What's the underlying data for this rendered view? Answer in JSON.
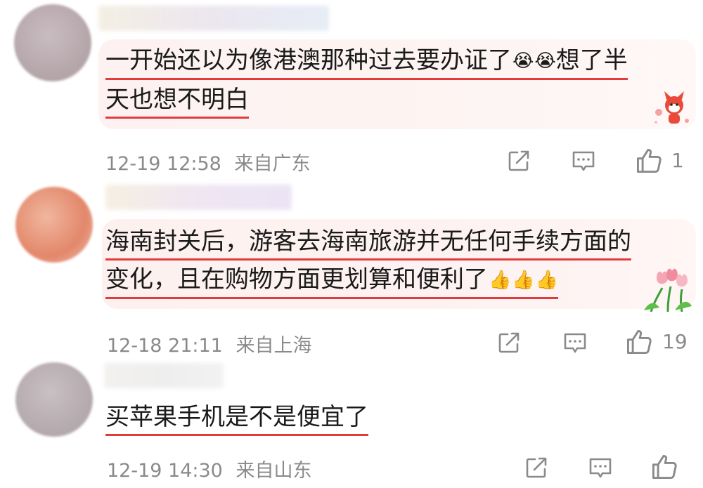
{
  "comments": [
    {
      "lines": [
        "一开始还以为像港澳那种过去要办证了",
        "天也想不明白"
      ],
      "line1_tail": "想了半",
      "emojis": [
        "😭",
        "😭"
      ],
      "time": "12-19 12:58",
      "location": "来自广东",
      "likes": "1",
      "avatar_color": "#b8a9ad",
      "bubble_color": "#fdf3f2"
    },
    {
      "lines": [
        "海南封关后，游客去海南旅游并无任何手续方面的",
        "变化，且在购物方面更划算和便利了"
      ],
      "emojis": [
        "👍",
        "👍",
        "👍"
      ],
      "time": "12-18 21:11",
      "location": "来自上海",
      "likes": "19",
      "avatar_color": "#e59a7e",
      "bubble_color": "#fdf1ef"
    },
    {
      "lines": [
        "买苹果手机是不是便宜了"
      ],
      "time": "12-19 14:30",
      "location": "来自山东",
      "likes": "",
      "avatar_color": "#b9b0b3",
      "bubble_color": "#ffffff"
    }
  ],
  "icons": {
    "share": "share-icon",
    "comment": "comment-icon",
    "like": "thumbs-up-icon"
  }
}
